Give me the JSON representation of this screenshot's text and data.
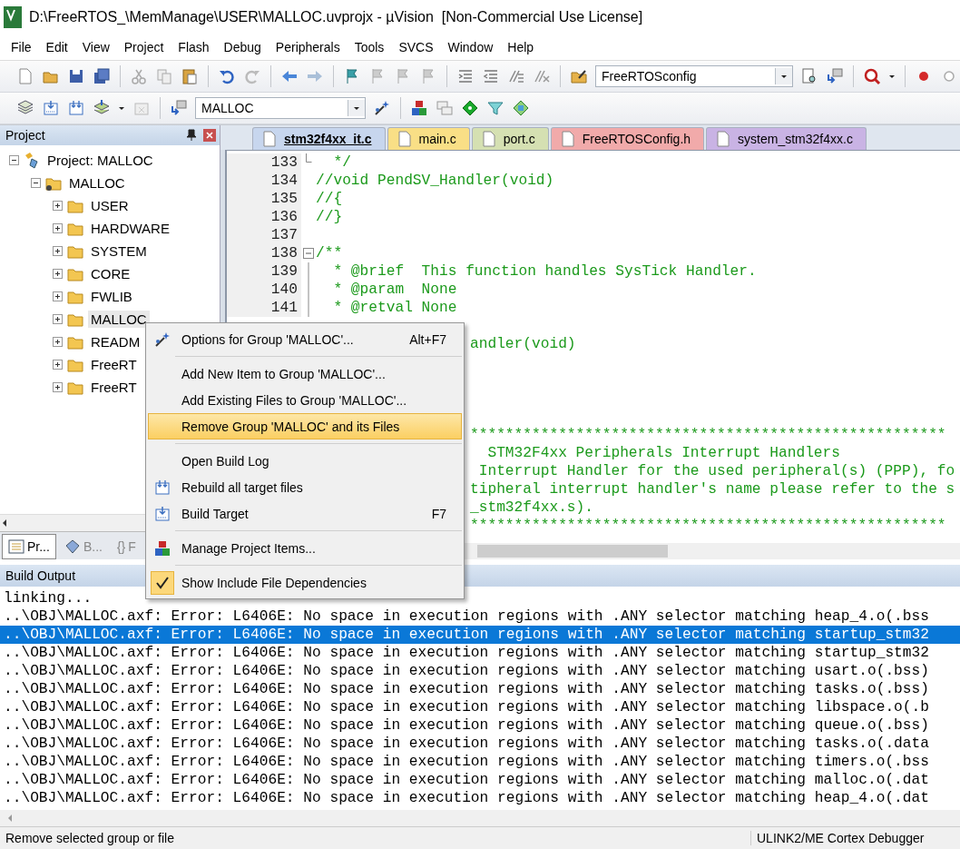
{
  "window": {
    "title": "D:\\FreeRTOS_\\MemManage\\USER\\MALLOC.uvprojx - µVision  [Non-Commercial Use License]"
  },
  "menu_bar": [
    "File",
    "Edit",
    "View",
    "Project",
    "Flash",
    "Debug",
    "Peripherals",
    "Tools",
    "SVCS",
    "Window",
    "Help"
  ],
  "toolbar": {
    "config_combo": {
      "value": "FreeRTOSconfig"
    }
  },
  "build_toolbar": {
    "target_combo": {
      "value": "MALLOC"
    }
  },
  "project_panel": {
    "title": "Project",
    "tree": [
      {
        "label": "Project: MALLOC",
        "expanded": true,
        "selected": false,
        "children": [
          {
            "label": "MALLOC",
            "expanded": true,
            "selected": false,
            "children": [
              {
                "label": "USER",
                "expanded": false,
                "selected": false
              },
              {
                "label": "HARDWARE",
                "expanded": false,
                "selected": false
              },
              {
                "label": "SYSTEM",
                "expanded": false,
                "selected": false
              },
              {
                "label": "CORE",
                "expanded": false,
                "selected": false
              },
              {
                "label": "FWLIB",
                "expanded": false,
                "selected": false
              },
              {
                "label": "MALLOC",
                "expanded": false,
                "selected": true
              },
              {
                "label": "READM",
                "expanded": false,
                "selected": false
              },
              {
                "label": "FreeRT",
                "expanded": false,
                "selected": false
              },
              {
                "label": "FreeRT",
                "expanded": false,
                "selected": false
              }
            ]
          }
        ]
      }
    ],
    "tabs": [
      {
        "label": "Pr...",
        "selected": true
      },
      {
        "label": "B...",
        "selected": false
      },
      {
        "icon_text": "{}",
        "label": "F",
        "selected": false
      }
    ]
  },
  "editor": {
    "tabs": [
      {
        "label": "stm32f4xx_it.c",
        "selected": true,
        "color": "#c7d6ee"
      },
      {
        "label": "main.c",
        "selected": false,
        "color": "#f9df86"
      },
      {
        "label": "port.c",
        "selected": false,
        "color": "#d5e0b2"
      },
      {
        "label": "FreeRTOSConfig.h",
        "selected": false,
        "color": "#f1aaaa"
      },
      {
        "label": "system_stm32f4xx.c",
        "selected": false,
        "color": "#c9b3e4"
      }
    ],
    "lines": [
      {
        "number": "133",
        "text": "  */",
        "fold_end": true
      },
      {
        "number": "134",
        "text": "//void PendSV_Handler(void)"
      },
      {
        "number": "135",
        "text": "//{"
      },
      {
        "number": "136",
        "text": "//}"
      },
      {
        "number": "137"
      },
      {
        "number": "138",
        "text": "/**",
        "fold_start": true
      },
      {
        "number": "139",
        "text": "  * @brief  This function handles SysTick Handler.",
        "in_fold": true
      },
      {
        "number": "140",
        "text": "  * @param  None",
        "in_fold": true
      },
      {
        "number": "141",
        "text": "  * @retval None",
        "in_fold": true
      },
      {
        "covered": true,
        "text": "andler(void)"
      },
      {
        "covered": true,
        "text": "******************************************************"
      },
      {
        "covered": true,
        "text": "  STM32F4xx Peripherals Interrupt Handlers"
      },
      {
        "covered": true,
        "text": " Interrupt Handler for the used peripheral(s) (PPP), fo"
      },
      {
        "covered": true,
        "text": "tipheral interrupt handler's name please refer to the s"
      },
      {
        "covered": true,
        "text": "_stm32f4xx.s)."
      },
      {
        "covered": true,
        "text": "******************************************************"
      }
    ]
  },
  "context_menu": {
    "items": [
      {
        "kind": "item",
        "label": "Options for Group 'MALLOC'...",
        "shortcut": "Alt+F7",
        "selected": false,
        "checked": false
      },
      {
        "kind": "separator"
      },
      {
        "kind": "item",
        "label": "Add New  Item to Group 'MALLOC'...",
        "selected": false,
        "checked": false
      },
      {
        "kind": "item",
        "label": "Add Existing Files to Group 'MALLOC'...",
        "selected": false,
        "checked": false
      },
      {
        "kind": "item",
        "label": "Remove Group 'MALLOC' and its Files",
        "selected": true,
        "checked": false
      },
      {
        "kind": "separator"
      },
      {
        "kind": "item",
        "label": "Open Build Log",
        "selected": false,
        "checked": false
      },
      {
        "kind": "item",
        "label": "Rebuild all target files",
        "selected": false,
        "checked": false
      },
      {
        "kind": "item",
        "label": "Build Target",
        "shortcut": "F7",
        "selected": false,
        "checked": false
      },
      {
        "kind": "separator"
      },
      {
        "kind": "item",
        "label": "Manage Project Items...",
        "selected": false,
        "checked": false
      },
      {
        "kind": "separator"
      },
      {
        "kind": "item",
        "label": "Show Include File Dependencies",
        "selected": false,
        "checked": true
      }
    ]
  },
  "build_output": {
    "title": "Build Output",
    "lines": [
      {
        "text": "linking...",
        "selected": false
      },
      {
        "text": "..\\OBJ\\MALLOC.axf: Error: L6406E: No space in execution regions with .ANY selector matching heap_4.o(.bss",
        "selected": false
      },
      {
        "text": "..\\OBJ\\MALLOC.axf: Error: L6406E: No space in execution regions with .ANY selector matching startup_stm32",
        "selected": true
      },
      {
        "text": "..\\OBJ\\MALLOC.axf: Error: L6406E: No space in execution regions with .ANY selector matching startup_stm32",
        "selected": false
      },
      {
        "text": "..\\OBJ\\MALLOC.axf: Error: L6406E: No space in execution regions with .ANY selector matching usart.o(.bss)",
        "selected": false
      },
      {
        "text": "..\\OBJ\\MALLOC.axf: Error: L6406E: No space in execution regions with .ANY selector matching tasks.o(.bss)",
        "selected": false
      },
      {
        "text": "..\\OBJ\\MALLOC.axf: Error: L6406E: No space in execution regions with .ANY selector matching libspace.o(.b",
        "selected": false
      },
      {
        "text": "..\\OBJ\\MALLOC.axf: Error: L6406E: No space in execution regions with .ANY selector matching queue.o(.bss)",
        "selected": false
      },
      {
        "text": "..\\OBJ\\MALLOC.axf: Error: L6406E: No space in execution regions with .ANY selector matching tasks.o(.data",
        "selected": false
      },
      {
        "text": "..\\OBJ\\MALLOC.axf: Error: L6406E: No space in execution regions with .ANY selector matching timers.o(.bss",
        "selected": false
      },
      {
        "text": "..\\OBJ\\MALLOC.axf: Error: L6406E: No space in execution regions with .ANY selector matching malloc.o(.dat",
        "selected": false
      },
      {
        "text": "..\\OBJ\\MALLOC.axf: Error: L6406E: No space in execution regions with .ANY selector matching heap_4.o(.dat",
        "selected": false
      }
    ]
  },
  "status_bar": {
    "message": "Remove selected group or file",
    "debugger": "ULINK2/ME Cortex Debugger"
  }
}
